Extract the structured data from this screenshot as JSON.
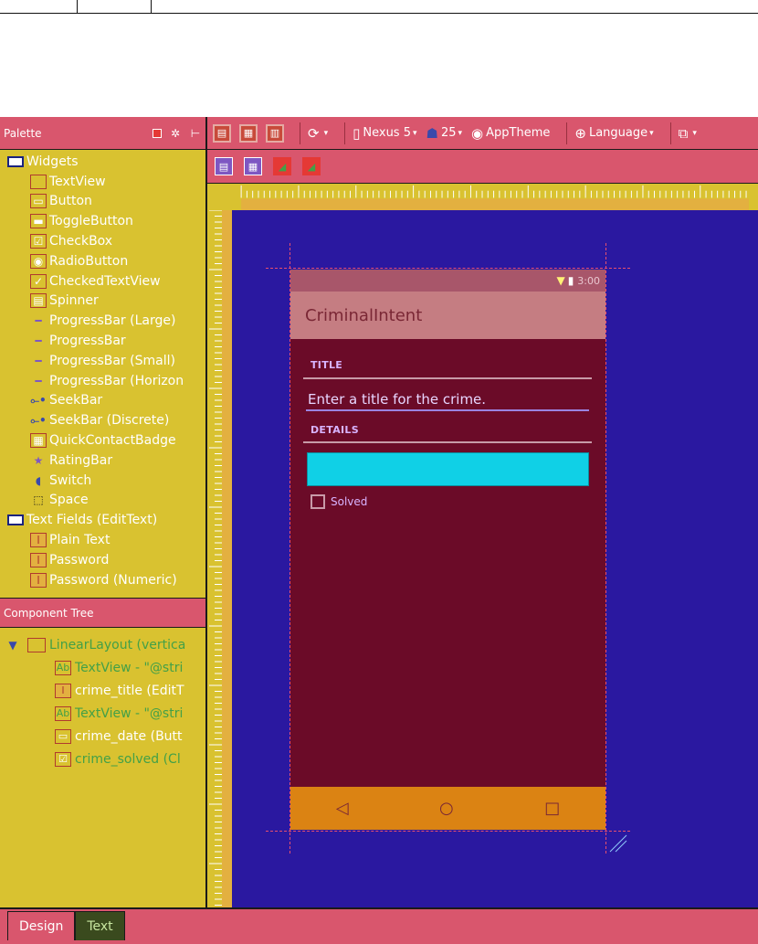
{
  "palette": {
    "header": "Palette",
    "categories": [
      {
        "label": "Widgets",
        "items": [
          {
            "label": "TextView",
            "icon": "textview-icon"
          },
          {
            "label": "Button",
            "icon": "button-icon"
          },
          {
            "label": "ToggleButton",
            "icon": "togglebutton-icon"
          },
          {
            "label": "CheckBox",
            "icon": "checkbox-icon"
          },
          {
            "label": "RadioButton",
            "icon": "radiobutton-icon"
          },
          {
            "label": "CheckedTextView",
            "icon": "checkedtextview-icon"
          },
          {
            "label": "Spinner",
            "icon": "spinner-icon"
          },
          {
            "label": "ProgressBar (Large)",
            "icon": "progressbar-icon"
          },
          {
            "label": "ProgressBar",
            "icon": "progressbar-icon"
          },
          {
            "label": "ProgressBar (Small)",
            "icon": "progressbar-icon"
          },
          {
            "label": "ProgressBar (Horizon",
            "icon": "progressbar-icon"
          },
          {
            "label": "SeekBar",
            "icon": "seekbar-icon"
          },
          {
            "label": "SeekBar (Discrete)",
            "icon": "seekbar-icon"
          },
          {
            "label": "QuickContactBadge",
            "icon": "contact-badge-icon"
          },
          {
            "label": "RatingBar",
            "icon": "star-icon"
          },
          {
            "label": "Switch",
            "icon": "switch-icon"
          },
          {
            "label": "Space",
            "icon": "space-icon"
          }
        ]
      },
      {
        "label": "Text Fields (EditText)",
        "items": [
          {
            "label": "Plain Text",
            "icon": "edittext-icon"
          },
          {
            "label": "Password",
            "icon": "edittext-icon"
          },
          {
            "label": "Password (Numeric)",
            "icon": "edittext-icon"
          }
        ]
      }
    ]
  },
  "component_tree": {
    "header": "Component Tree",
    "root": "LinearLayout (vertica",
    "children": [
      {
        "label": "TextView - \"@stri",
        "icon": "textview-icon"
      },
      {
        "label": "crime_title (EditT",
        "icon": "edittext-icon"
      },
      {
        "label": "TextView - \"@stri",
        "icon": "textview-icon"
      },
      {
        "label": "crime_date (Butt",
        "icon": "button-icon"
      },
      {
        "label": "crime_solved (Cl",
        "icon": "checkbox-icon"
      }
    ]
  },
  "toolbar": {
    "device": "Nexus 5",
    "api": "25",
    "theme": "AppTheme",
    "language": "Language"
  },
  "device": {
    "time": "3:00",
    "app_title": "CriminalIntent",
    "title_label": "TITLE",
    "title_placeholder": "Enter a title for the crime.",
    "details_label": "DETAILS",
    "solved_label": "Solved"
  },
  "bottom_tabs": {
    "design": "Design",
    "text": "Text"
  },
  "colors": {
    "panel": "#d9c230",
    "header": "#d9566d",
    "canvas": "#2a18a0",
    "device_bg": "#6b0b28",
    "date_button": "#10d0e6",
    "nav_bar": "#db8313"
  }
}
